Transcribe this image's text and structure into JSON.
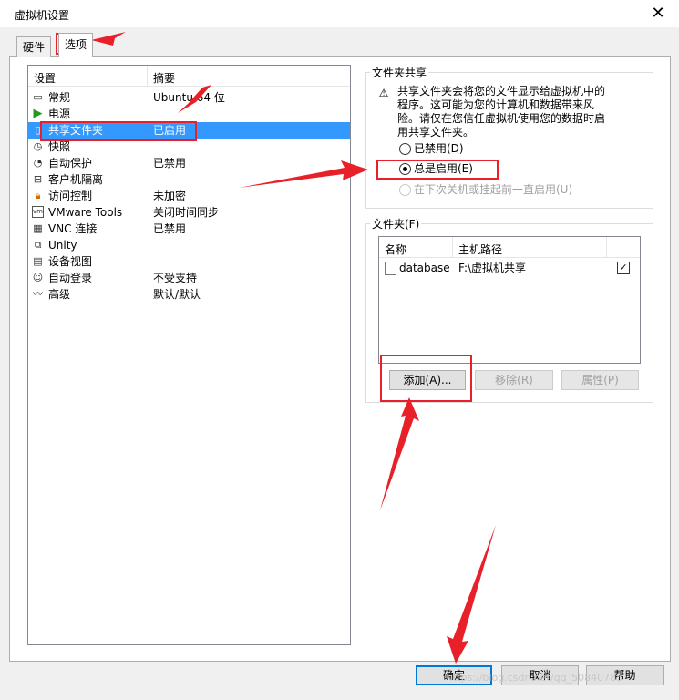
{
  "window": {
    "title": "虚拟机设置",
    "close": "✕"
  },
  "tabs": [
    {
      "label": "硬件"
    },
    {
      "label": "选项"
    }
  ],
  "settings": {
    "header_setting": "设置",
    "header_summary": "摘要",
    "rows": [
      {
        "name": "常规",
        "summary": "Ubuntu 64 位",
        "icon": "general-icon"
      },
      {
        "name": "电源",
        "summary": "",
        "icon": "power-icon"
      },
      {
        "name": "共享文件夹",
        "summary": "已启用",
        "icon": "shared-folder-icon",
        "selected": true
      },
      {
        "name": "快照",
        "summary": "",
        "icon": "snapshot-icon"
      },
      {
        "name": "自动保护",
        "summary": "已禁用",
        "icon": "autoprotect-icon"
      },
      {
        "name": "客户机隔离",
        "summary": "",
        "icon": "guest-isolation-icon"
      },
      {
        "name": "访问控制",
        "summary": "未加密",
        "icon": "access-control-icon"
      },
      {
        "name": "VMware Tools",
        "summary": "关闭时间同步",
        "icon": "vmware-tools-icon"
      },
      {
        "name": "VNC 连接",
        "summary": "已禁用",
        "icon": "vnc-icon"
      },
      {
        "name": "Unity",
        "summary": "",
        "icon": "unity-icon"
      },
      {
        "name": "设备视图",
        "summary": "",
        "icon": "device-view-icon"
      },
      {
        "name": "自动登录",
        "summary": "不受支持",
        "icon": "autologin-icon"
      },
      {
        "name": "高级",
        "summary": "默认/默认",
        "icon": "advanced-icon"
      }
    ]
  },
  "sharing": {
    "group_title": "文件夹共享",
    "warning": "共享文件夹会将您的文件显示给虚拟机中的程序。这可能为您的计算机和数据带来风险。请仅在您信任虚拟机使用您的数据时启用共享文件夹。",
    "options": [
      {
        "label": "已禁用(D)",
        "checked": false,
        "enabled": true
      },
      {
        "label": "总是启用(E)",
        "checked": true,
        "enabled": true
      },
      {
        "label": "在下次关机或挂起前一直启用(U)",
        "checked": false,
        "enabled": false
      }
    ]
  },
  "folders": {
    "group_title": "文件夹(F)",
    "col_name": "名称",
    "col_path": "主机路径",
    "rows": [
      {
        "name": "database",
        "path": "F:\\虚拟机共享",
        "checked": true
      }
    ],
    "add": "添加(A)...",
    "remove": "移除(R)",
    "properties": "属性(P)"
  },
  "footer": {
    "ok": "确定",
    "cancel": "取消",
    "help": "帮助"
  },
  "watermark": "https://blog.csdn.net/qq_50840785",
  "colors": {
    "selection": "#3399ff",
    "annotation": "#e8202a"
  }
}
